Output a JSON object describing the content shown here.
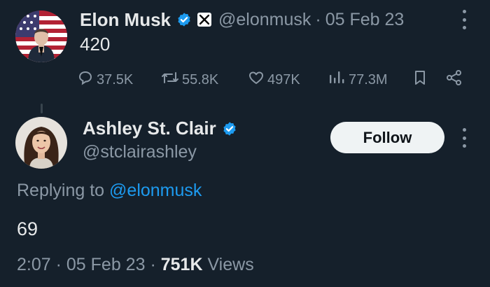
{
  "parent_tweet": {
    "author_name": "Elon Musk",
    "handle": "@elonmusk",
    "separator": "·",
    "date": "05 Feb 23",
    "text": "420",
    "stats": {
      "replies": "37.5K",
      "retweets": "55.8K",
      "likes": "497K",
      "views": "77.3M"
    },
    "icons": {
      "verified": "verified-badge-icon",
      "affiliate": "x-logo-icon",
      "more": "more-options-icon",
      "reply": "reply-icon",
      "retweet": "retweet-icon",
      "like": "heart-icon",
      "views": "views-icon",
      "bookmark": "bookmark-icon",
      "share": "share-icon"
    }
  },
  "reply_tweet": {
    "author_name": "Ashley St. Clair",
    "handle": "@stclairashley",
    "follow_label": "Follow",
    "replying_prefix": "Replying to",
    "replying_to": "@elonmusk",
    "text": "69",
    "time": "2:07",
    "separator": "·",
    "date": "05 Feb 23",
    "views_count": "751K",
    "views_label": "Views"
  },
  "colors": {
    "background": "#15202b",
    "primary_text": "#e7e9ea",
    "secondary_text": "#8b98a5",
    "accent": "#1d9bf0"
  }
}
